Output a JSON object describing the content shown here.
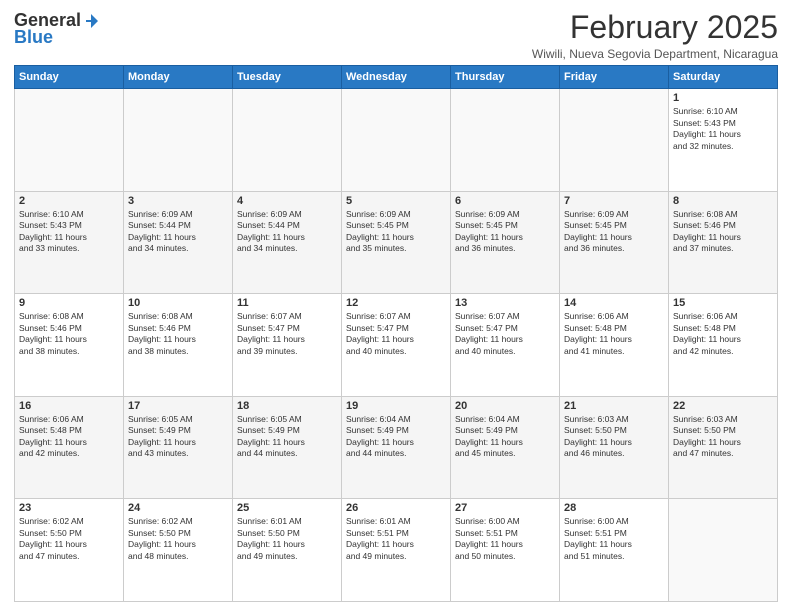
{
  "header": {
    "logo_general": "General",
    "logo_blue": "Blue",
    "title": "February 2025",
    "location": "Wiwili, Nueva Segovia Department, Nicaragua"
  },
  "weekdays": [
    "Sunday",
    "Monday",
    "Tuesday",
    "Wednesday",
    "Thursday",
    "Friday",
    "Saturday"
  ],
  "weeks": [
    [
      {
        "day": "",
        "info": ""
      },
      {
        "day": "",
        "info": ""
      },
      {
        "day": "",
        "info": ""
      },
      {
        "day": "",
        "info": ""
      },
      {
        "day": "",
        "info": ""
      },
      {
        "day": "",
        "info": ""
      },
      {
        "day": "1",
        "info": "Sunrise: 6:10 AM\nSunset: 5:43 PM\nDaylight: 11 hours\nand 32 minutes."
      }
    ],
    [
      {
        "day": "2",
        "info": "Sunrise: 6:10 AM\nSunset: 5:43 PM\nDaylight: 11 hours\nand 33 minutes."
      },
      {
        "day": "3",
        "info": "Sunrise: 6:09 AM\nSunset: 5:44 PM\nDaylight: 11 hours\nand 34 minutes."
      },
      {
        "day": "4",
        "info": "Sunrise: 6:09 AM\nSunset: 5:44 PM\nDaylight: 11 hours\nand 34 minutes."
      },
      {
        "day": "5",
        "info": "Sunrise: 6:09 AM\nSunset: 5:45 PM\nDaylight: 11 hours\nand 35 minutes."
      },
      {
        "day": "6",
        "info": "Sunrise: 6:09 AM\nSunset: 5:45 PM\nDaylight: 11 hours\nand 36 minutes."
      },
      {
        "day": "7",
        "info": "Sunrise: 6:09 AM\nSunset: 5:45 PM\nDaylight: 11 hours\nand 36 minutes."
      },
      {
        "day": "8",
        "info": "Sunrise: 6:08 AM\nSunset: 5:46 PM\nDaylight: 11 hours\nand 37 minutes."
      }
    ],
    [
      {
        "day": "9",
        "info": "Sunrise: 6:08 AM\nSunset: 5:46 PM\nDaylight: 11 hours\nand 38 minutes."
      },
      {
        "day": "10",
        "info": "Sunrise: 6:08 AM\nSunset: 5:46 PM\nDaylight: 11 hours\nand 38 minutes."
      },
      {
        "day": "11",
        "info": "Sunrise: 6:07 AM\nSunset: 5:47 PM\nDaylight: 11 hours\nand 39 minutes."
      },
      {
        "day": "12",
        "info": "Sunrise: 6:07 AM\nSunset: 5:47 PM\nDaylight: 11 hours\nand 40 minutes."
      },
      {
        "day": "13",
        "info": "Sunrise: 6:07 AM\nSunset: 5:47 PM\nDaylight: 11 hours\nand 40 minutes."
      },
      {
        "day": "14",
        "info": "Sunrise: 6:06 AM\nSunset: 5:48 PM\nDaylight: 11 hours\nand 41 minutes."
      },
      {
        "day": "15",
        "info": "Sunrise: 6:06 AM\nSunset: 5:48 PM\nDaylight: 11 hours\nand 42 minutes."
      }
    ],
    [
      {
        "day": "16",
        "info": "Sunrise: 6:06 AM\nSunset: 5:48 PM\nDaylight: 11 hours\nand 42 minutes."
      },
      {
        "day": "17",
        "info": "Sunrise: 6:05 AM\nSunset: 5:49 PM\nDaylight: 11 hours\nand 43 minutes."
      },
      {
        "day": "18",
        "info": "Sunrise: 6:05 AM\nSunset: 5:49 PM\nDaylight: 11 hours\nand 44 minutes."
      },
      {
        "day": "19",
        "info": "Sunrise: 6:04 AM\nSunset: 5:49 PM\nDaylight: 11 hours\nand 44 minutes."
      },
      {
        "day": "20",
        "info": "Sunrise: 6:04 AM\nSunset: 5:49 PM\nDaylight: 11 hours\nand 45 minutes."
      },
      {
        "day": "21",
        "info": "Sunrise: 6:03 AM\nSunset: 5:50 PM\nDaylight: 11 hours\nand 46 minutes."
      },
      {
        "day": "22",
        "info": "Sunrise: 6:03 AM\nSunset: 5:50 PM\nDaylight: 11 hours\nand 47 minutes."
      }
    ],
    [
      {
        "day": "23",
        "info": "Sunrise: 6:02 AM\nSunset: 5:50 PM\nDaylight: 11 hours\nand 47 minutes."
      },
      {
        "day": "24",
        "info": "Sunrise: 6:02 AM\nSunset: 5:50 PM\nDaylight: 11 hours\nand 48 minutes."
      },
      {
        "day": "25",
        "info": "Sunrise: 6:01 AM\nSunset: 5:50 PM\nDaylight: 11 hours\nand 49 minutes."
      },
      {
        "day": "26",
        "info": "Sunrise: 6:01 AM\nSunset: 5:51 PM\nDaylight: 11 hours\nand 49 minutes."
      },
      {
        "day": "27",
        "info": "Sunrise: 6:00 AM\nSunset: 5:51 PM\nDaylight: 11 hours\nand 50 minutes."
      },
      {
        "day": "28",
        "info": "Sunrise: 6:00 AM\nSunset: 5:51 PM\nDaylight: 11 hours\nand 51 minutes."
      },
      {
        "day": "",
        "info": ""
      }
    ]
  ]
}
